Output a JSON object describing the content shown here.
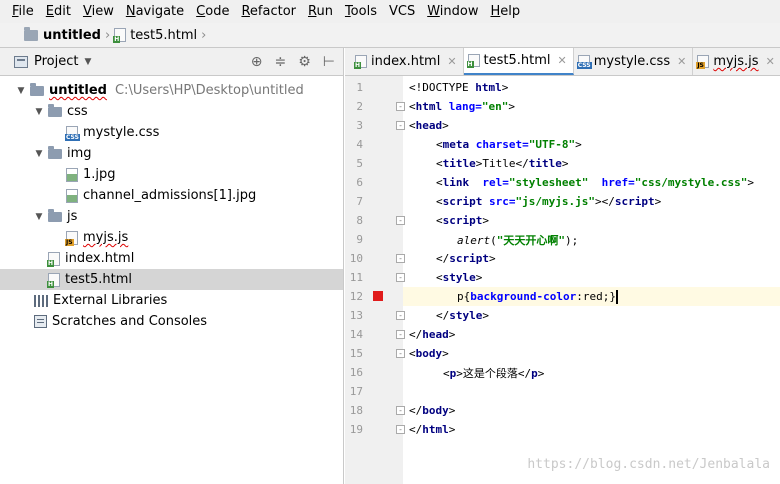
{
  "menu": {
    "items": [
      {
        "first": "F",
        "rest": "ile"
      },
      {
        "first": "E",
        "rest": "dit"
      },
      {
        "first": "V",
        "rest": "iew"
      },
      {
        "first": "N",
        "rest": "avigate"
      },
      {
        "first": "C",
        "rest": "ode"
      },
      {
        "first": "R",
        "rest": "efactor"
      },
      {
        "first": "R",
        "rest": "un"
      },
      {
        "first": "T",
        "rest": "ools"
      },
      {
        "first": "",
        "rest": "VCS"
      },
      {
        "first": "W",
        "rest": "indow"
      },
      {
        "first": "H",
        "rest": "elp"
      }
    ]
  },
  "breadcrumb": {
    "project": "untitled",
    "file": "test5.html"
  },
  "project_panel": {
    "title": "Project",
    "tree": [
      {
        "name": "untitled",
        "path": "C:\\Users\\HP\\Desktop\\untitled"
      },
      {
        "name": "css"
      },
      {
        "name": "mystyle.css"
      },
      {
        "name": "img"
      },
      {
        "name": "1.jpg"
      },
      {
        "name": "channel_admissions[1].jpg"
      },
      {
        "name": "js"
      },
      {
        "name": "myjs.js"
      },
      {
        "name": "index.html"
      },
      {
        "name": "test5.html"
      },
      {
        "name": "External Libraries"
      },
      {
        "name": "Scratches and Consoles"
      }
    ]
  },
  "editor": {
    "tabs": [
      "index.html",
      "test5.html",
      "mystyle.css",
      "myjs.js"
    ],
    "active_tab": "test5.html",
    "line_numbers": [
      "1",
      "2",
      "3",
      "4",
      "5",
      "6",
      "7",
      "8",
      "9",
      "10",
      "11",
      "12",
      "13",
      "14",
      "15",
      "16",
      "17",
      "18",
      "19"
    ],
    "code": {
      "l1": [
        "<!DOCTYPE ",
        "html",
        ">"
      ],
      "l2": [
        "<",
        "html ",
        "lang=",
        "\"en\"",
        ">"
      ],
      "l3": [
        "<",
        "head",
        ">"
      ],
      "l4": [
        "<",
        "meta ",
        "charset=",
        "\"UTF-8\"",
        ">"
      ],
      "l5": [
        "<",
        "title",
        ">",
        "Title",
        "</",
        "title",
        ">"
      ],
      "l6": [
        "<",
        "link  ",
        "rel=",
        "\"stylesheet\"",
        "  ",
        "href=",
        "\"css/mystyle.css\"",
        ">"
      ],
      "l7": [
        "<",
        "script ",
        "src=",
        "\"js/myjs.js\"",
        "></",
        "script",
        ">"
      ],
      "l8": [
        "<",
        "script",
        ">"
      ],
      "l9": [
        "alert",
        "(",
        "\"天天开心啊\"",
        ");"
      ],
      "l10": [
        "</",
        "script",
        ">"
      ],
      "l11": [
        "<",
        "style",
        ">"
      ],
      "l12": [
        "p",
        "{",
        "background-color",
        ":",
        "red",
        ";}"
      ],
      "l13": [
        "</",
        "style",
        ">"
      ],
      "l14": [
        "</",
        "head",
        ">"
      ],
      "l15": [
        "<",
        "body",
        ">"
      ],
      "l16": [
        "<",
        "p",
        ">",
        "这是个段落",
        "</",
        "p",
        ">"
      ],
      "l18": [
        "</",
        "body",
        ">"
      ],
      "l19": [
        "</",
        "html",
        ">"
      ]
    }
  },
  "watermark": "https://blog.csdn.net/Jenbalala",
  "colors": {
    "tag": "#000080",
    "attr": "#0000ff",
    "string": "#008000",
    "breakpoint": "#e01b1b",
    "tab_underline": "#4083c9"
  },
  "icons": {
    "folder": "folder-icon",
    "css": "css-file-icon",
    "html": "html-file-icon",
    "js": "js-file-icon",
    "image": "image-file-icon",
    "library": "library-icon",
    "scratch": "scratch-icon",
    "breakpoint": "breakpoint-icon"
  }
}
